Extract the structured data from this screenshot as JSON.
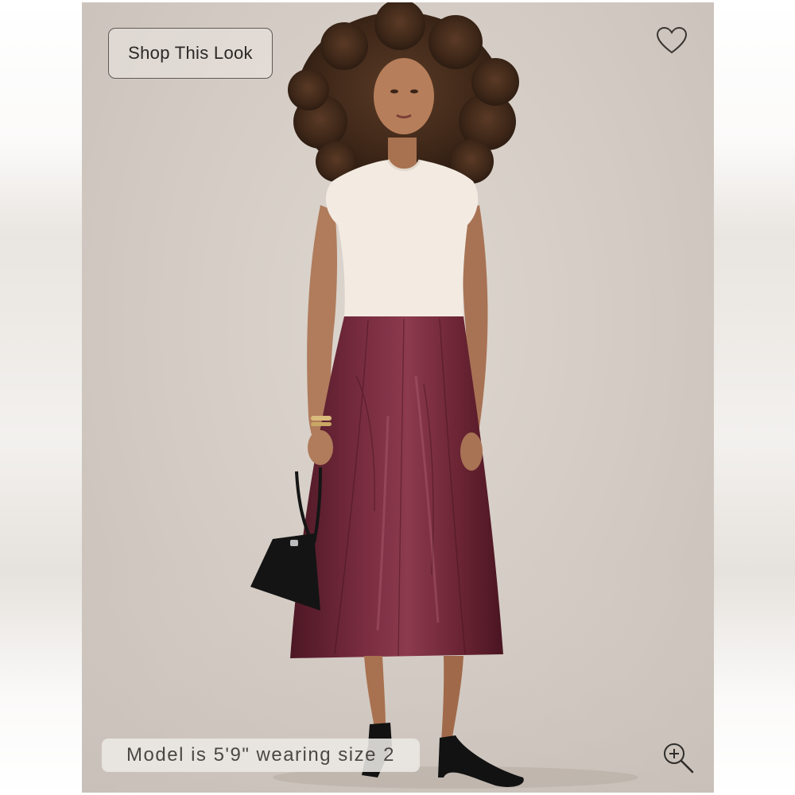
{
  "product_image": {
    "alt": "Model wearing a sleeveless cream sweater and a burgundy croc-embossed leather A-line midi skirt, holding a black handbag"
  },
  "shop_look": {
    "label": "Shop This Look"
  },
  "favorite": {
    "icon": "heart-outline-icon"
  },
  "model_info": {
    "text": "Model is 5'9\" wearing size 2"
  },
  "zoom": {
    "icon": "zoom-in-icon"
  },
  "colors": {
    "background": "#d6cfc8",
    "skirt": "#6b2535",
    "top": "#f3ebe2",
    "button_border": "#5e5a56",
    "caption_text": "#4b4744"
  }
}
